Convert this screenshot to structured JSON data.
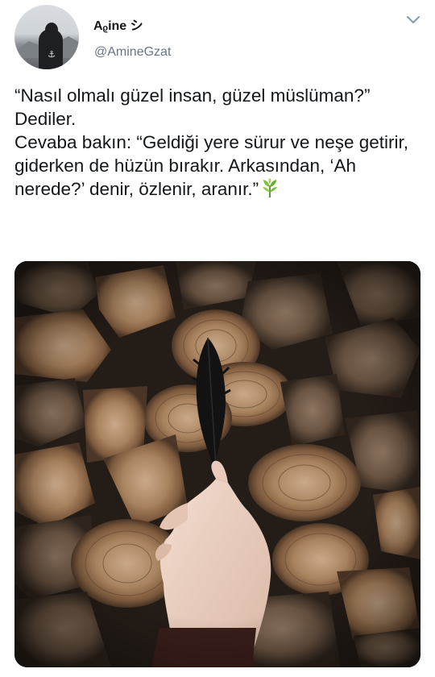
{
  "tweet": {
    "author": {
      "display_name": "Aᵨine シ",
      "handle": "@AmineGzat",
      "avatar_icon": "hooded-figure-avatar"
    },
    "menu_icon": "chevron-down-icon",
    "text": "“Nasıl olmalı güzel insan, güzel müslüman?”\nDediler.\nCevaba bakın: “Geldiği yere sürur ve neşe getirir, giderken de hüzün bırakır. Arkasından, ‘Ah nerede?’ denir, özlenir, aranır.”",
    "text_emoji": "herb-emoji",
    "media": {
      "kind": "photo",
      "subject": "hand-holding-black-feather-over-stacked-logs"
    }
  },
  "colors": {
    "text": "#14171a",
    "secondary": "#657786",
    "chevron": "#8899a6",
    "wood_light": "#b08d6b",
    "wood_dark": "#3a2c22"
  }
}
